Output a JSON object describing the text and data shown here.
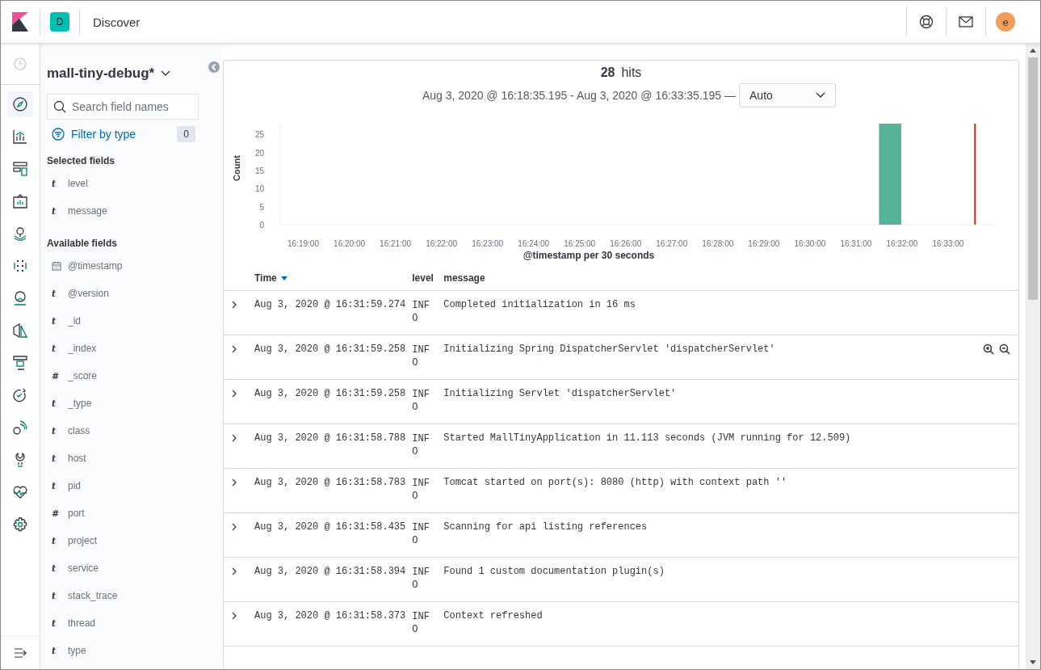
{
  "header": {
    "space_initial": "D",
    "title": "Discover",
    "user_initial": "e"
  },
  "sidebar": {
    "index_pattern": "mall-tiny-debug*",
    "search_placeholder": "Search field names",
    "filter_label": "Filter by type",
    "filter_count": "0",
    "selected_title": "Selected fields",
    "selected_fields": [
      {
        "kind": "text",
        "type_label": "t",
        "name": "level"
      },
      {
        "kind": "text",
        "type_label": "t",
        "name": "message"
      }
    ],
    "available_title": "Available fields",
    "available_fields": [
      {
        "kind": "date",
        "name": "@timestamp"
      },
      {
        "kind": "text",
        "type_label": "t",
        "name": "@version"
      },
      {
        "kind": "text",
        "type_label": "t",
        "name": "_id"
      },
      {
        "kind": "text",
        "type_label": "t",
        "name": "_index"
      },
      {
        "kind": "text",
        "type_label": "#",
        "name": "_score"
      },
      {
        "kind": "text",
        "type_label": "t",
        "name": "_type"
      },
      {
        "kind": "text",
        "type_label": "t",
        "name": "class"
      },
      {
        "kind": "text",
        "type_label": "t",
        "name": "host"
      },
      {
        "kind": "text",
        "type_label": "t",
        "name": "pid"
      },
      {
        "kind": "text",
        "type_label": "#",
        "name": "port"
      },
      {
        "kind": "text",
        "type_label": "t",
        "name": "project"
      },
      {
        "kind": "text",
        "type_label": "t",
        "name": "service"
      },
      {
        "kind": "text",
        "type_label": "t",
        "name": "stack_trace"
      },
      {
        "kind": "text",
        "type_label": "t",
        "name": "thread"
      },
      {
        "kind": "text",
        "type_label": "t",
        "name": "type"
      }
    ]
  },
  "summary": {
    "hits": "28",
    "hits_label": "hits",
    "range": "Aug 3, 2020 @ 16:18:35.195 - Aug 3, 2020 @ 16:33:35.195 —",
    "interval": "Auto"
  },
  "chart_data": {
    "type": "bar",
    "xlabel": "@timestamp per 30 seconds",
    "ylabel": "Count",
    "categories": [
      null,
      "16:19:00",
      null,
      "16:20:00",
      null,
      "16:21:00",
      null,
      "16:22:00",
      null,
      "16:23:00",
      null,
      "16:24:00",
      null,
      "16:25:00",
      null,
      "16:26:00",
      null,
      "16:27:00",
      null,
      "16:28:00",
      null,
      "16:29:00",
      null,
      "16:30:00",
      null,
      "16:31:00",
      null,
      "16:32:00",
      null,
      "16:33:00",
      null
    ],
    "values": [
      0,
      0,
      0,
      0,
      0,
      0,
      0,
      0,
      0,
      0,
      0,
      0,
      0,
      0,
      0,
      0,
      0,
      0,
      0,
      0,
      0,
      0,
      0,
      0,
      0,
      0,
      28,
      0,
      0,
      0,
      0
    ],
    "ylim": [
      0,
      28
    ],
    "yticks": [
      0,
      5,
      10,
      15,
      20,
      25
    ]
  },
  "table": {
    "columns": [
      {
        "label": "Time",
        "sorted": true
      },
      {
        "label": "level",
        "sorted": false
      },
      {
        "label": "message",
        "sorted": false
      }
    ],
    "rows": [
      {
        "time": "Aug 3, 2020 @ 16:31:59.274",
        "level": "INFO",
        "message": "Completed initialization in 16 ms",
        "show_actions": false
      },
      {
        "time": "Aug 3, 2020 @ 16:31:59.258",
        "level": "INFO",
        "message": "Initializing Spring DispatcherServlet 'dispatcherServlet'",
        "show_actions": true
      },
      {
        "time": "Aug 3, 2020 @ 16:31:59.258",
        "level": "INFO",
        "message": "Initializing Servlet 'dispatcherServlet'",
        "show_actions": false
      },
      {
        "time": "Aug 3, 2020 @ 16:31:58.788",
        "level": "INFO",
        "message": "Started MallTinyApplication in 11.113 seconds (JVM running for 12.509)",
        "show_actions": false
      },
      {
        "time": "Aug 3, 2020 @ 16:31:58.783",
        "level": "INFO",
        "message": "Tomcat started on port(s): 8080 (http) with context path ''",
        "show_actions": false
      },
      {
        "time": "Aug 3, 2020 @ 16:31:58.435",
        "level": "INFO",
        "message": "Scanning for api listing references",
        "show_actions": false
      },
      {
        "time": "Aug 3, 2020 @ 16:31:58.394",
        "level": "INFO",
        "message": "Found 1 custom documentation plugin(s)",
        "show_actions": false
      },
      {
        "time": "Aug 3, 2020 @ 16:31:58.373",
        "level": "INFO",
        "message": "Context refreshed",
        "show_actions": false
      }
    ]
  }
}
